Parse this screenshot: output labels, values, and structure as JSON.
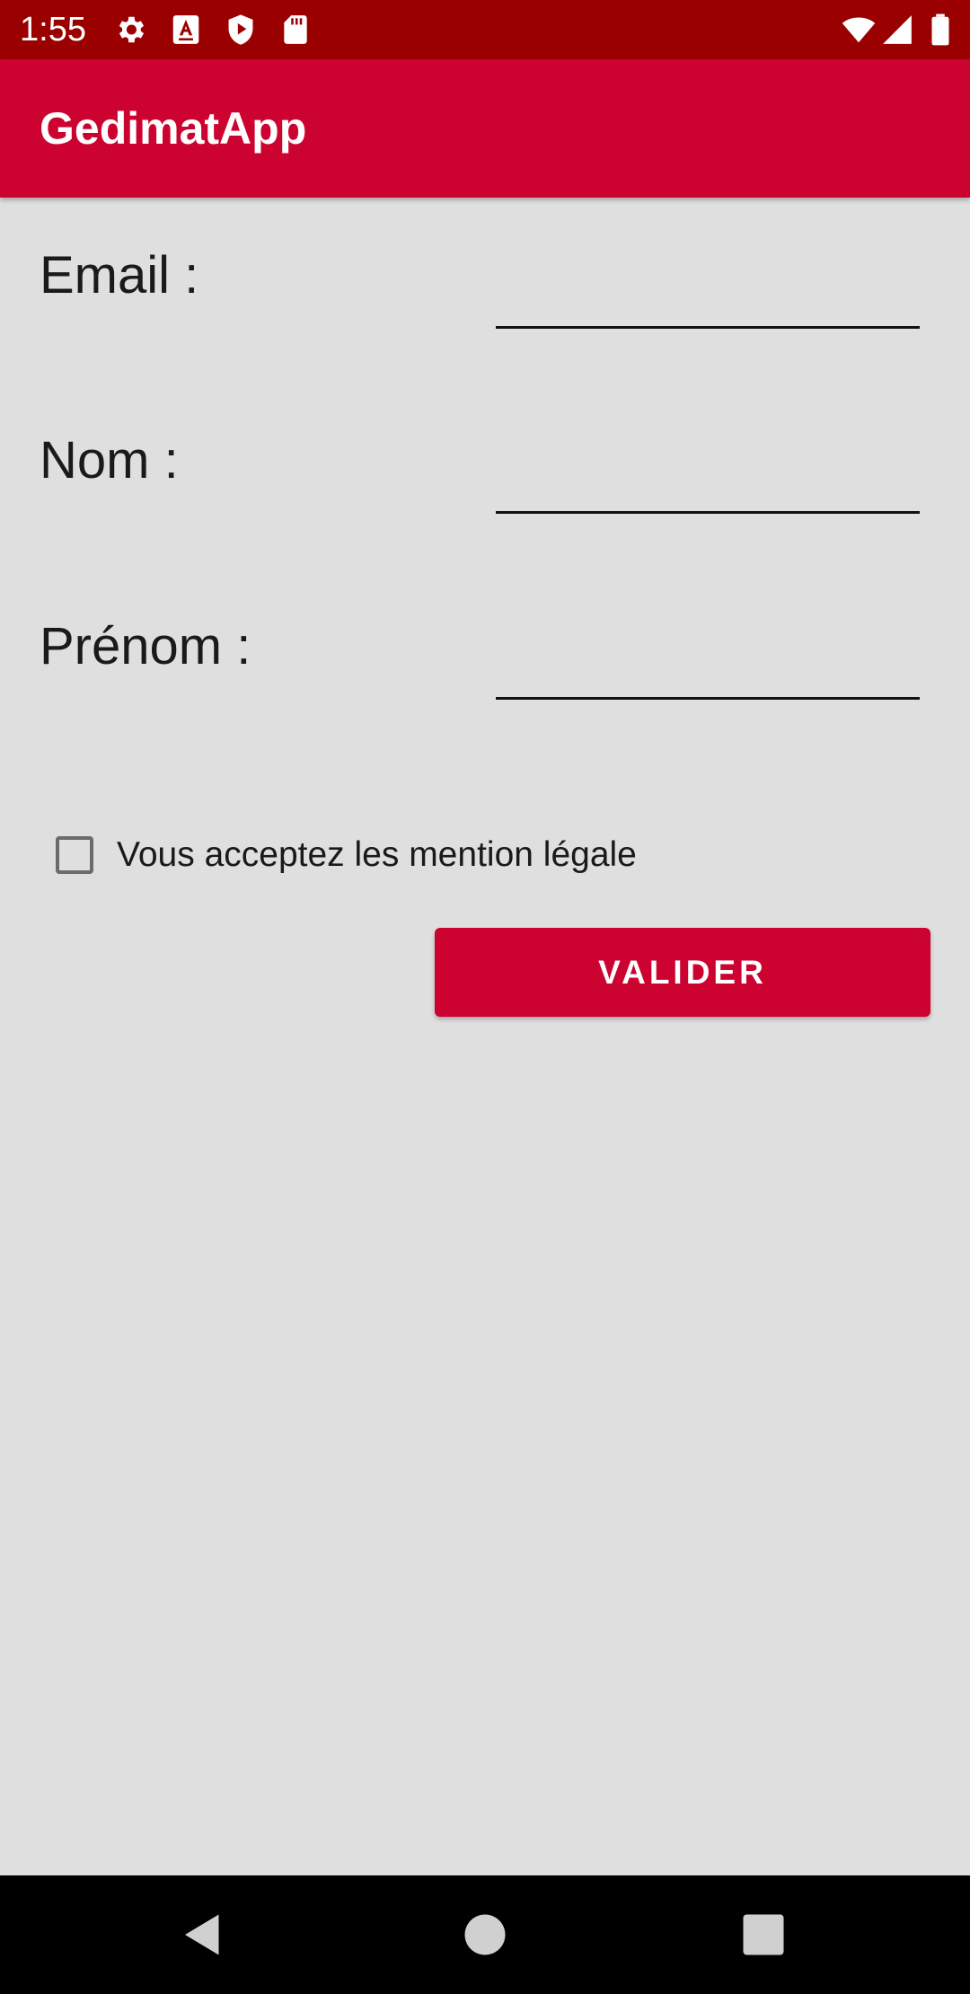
{
  "status_bar": {
    "time": "1:55",
    "icons_left": [
      "gear-icon",
      "font-a-icon",
      "shield-play-icon",
      "sd-card-icon"
    ],
    "icons_right": [
      "wifi-icon",
      "cell-signal-icon",
      "battery-icon"
    ]
  },
  "app_bar": {
    "title": "GedimatApp"
  },
  "form": {
    "email": {
      "label": "Email :",
      "value": ""
    },
    "nom": {
      "label": "Nom :",
      "value": ""
    },
    "prenom": {
      "label": "Prénom :",
      "value": ""
    },
    "terms": {
      "label": "Vous acceptez les mention légale",
      "checked": false
    },
    "submit_label": "VALIDER"
  },
  "nav_bar": {
    "buttons": [
      "back-icon",
      "home-icon",
      "recents-icon"
    ]
  },
  "colors": {
    "status_bar": "#9b0000",
    "app_bar": "#cc0330",
    "accent": "#cc0330",
    "background": "#e0dfdf"
  }
}
